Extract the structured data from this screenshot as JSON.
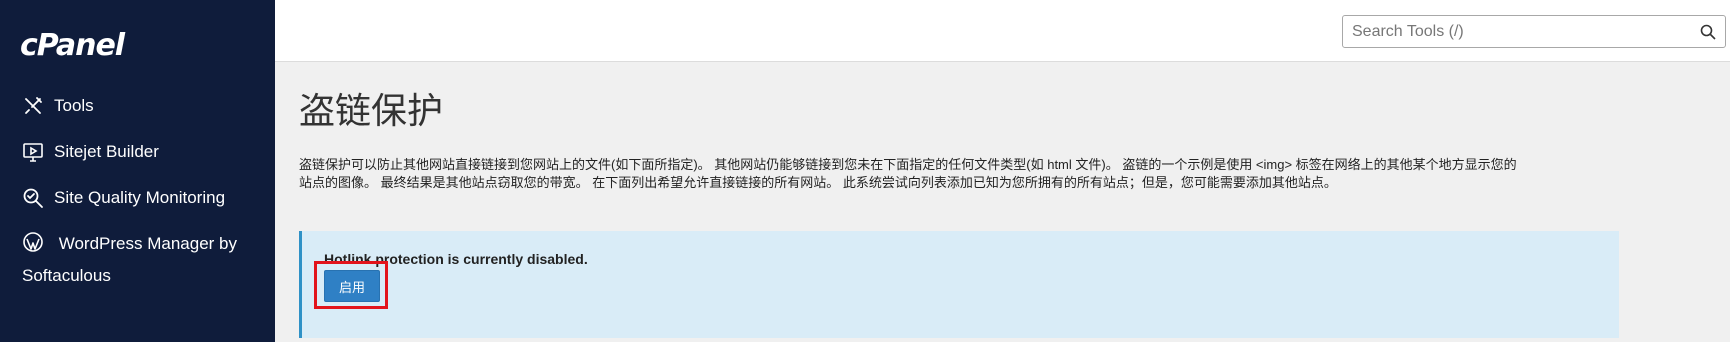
{
  "sidebar": {
    "logo": "cPanel",
    "items": [
      {
        "label": "Tools",
        "icon": "tools-icon"
      },
      {
        "label": "Sitejet Builder",
        "icon": "sitejet-icon"
      },
      {
        "label": "Site Quality Monitoring",
        "icon": "site-quality-icon"
      },
      {
        "label": "WordPress Manager by Softaculous",
        "icon": "wordpress-icon"
      }
    ]
  },
  "topbar": {
    "search_placeholder": "Search Tools (/)"
  },
  "page": {
    "title": "盗链保护",
    "description_line1": "盗链保护可以防止其他网站直接链接到您网站上的文件(如下面所指定)。 其他网站仍能够链接到您未在下面指定的任何文件类型(如 html 文件)。 盗链的一个示例是使用 <img> 标签在网络上的其他某个地方显示您的",
    "description_line2": "站点的图像。 最终结果是其他站点窃取您的带宽。 在下面列出希望允许直接链接的所有网站。 此系统尝试向列表添加已知为您所拥有的所有站点；但是，您可能需要添加其他站点。",
    "status_message": "Hotlink protection is currently disabled.",
    "enable_button": "启用"
  },
  "colors": {
    "sidebar_bg": "#0f1c3b",
    "alert_bg": "#d9ecf7",
    "button_bg": "#2f80c5",
    "highlight": "#e2141c"
  }
}
